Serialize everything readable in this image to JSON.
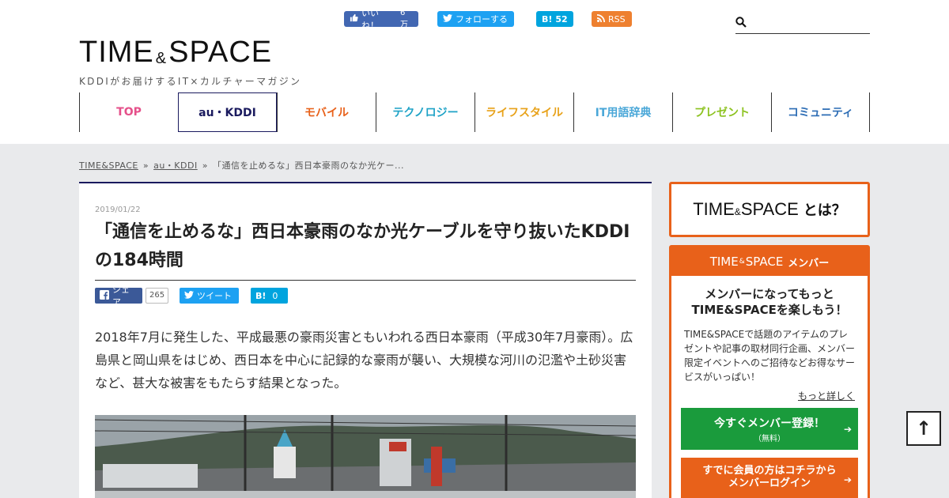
{
  "header": {
    "logo_main_a": "TIME",
    "logo_amp": "&",
    "logo_main_b": "SPACE",
    "logo_sub": "KDDIがお届けするIT×カルチャーマガジン",
    "social": {
      "fb_label": "いいね！",
      "fb_count": "6万",
      "tw_label": "フォローする",
      "hb_label": "B!",
      "hb_count": "52",
      "rss_label": "RSS"
    },
    "search_placeholder": ""
  },
  "nav": [
    {
      "label": "TOP",
      "color": "#e5508a"
    },
    {
      "label": "au・KDDI",
      "color": "#1a1a5e"
    },
    {
      "label": "モバイル",
      "color": "#e8611a"
    },
    {
      "label": "テクノロジー",
      "color": "#1fa3c7"
    },
    {
      "label": "ライフスタイル",
      "color": "#e8a21a"
    },
    {
      "label": "IT用語辞典",
      "color": "#4aa7d8"
    },
    {
      "label": "プレゼント",
      "color": "#8cc21f"
    },
    {
      "label": "コミュニティ",
      "color": "#2d6db5"
    }
  ],
  "breadcrumb": {
    "home": "TIME&SPACE",
    "cat": "au・KDDI",
    "current": "「通信を止めるな」西日本豪雨のなか光ケー..."
  },
  "article": {
    "date": "2019/01/22",
    "title": "「通信を止めるな」西日本豪雨のなか光ケーブルを守り抜いたKDDIの184時間",
    "share_fb": "シェア",
    "share_fb_count": "265",
    "share_tw": "ツイート",
    "share_hb": "B!",
    "share_hb_count": "0",
    "lead": "2018年7月に発生した、平成最悪の豪雨災害ともいわれる西日本豪雨（平成30年7月豪雨）。広島県と岡山県をはじめ、西日本を中心に記録的な豪雨が襲い、大規模な河川の氾濫や土砂災害など、甚大な被害をもたらす結果となった。"
  },
  "sidebar": {
    "about_a": "TIME",
    "about_amp": "&",
    "about_b": "SPACE",
    "about_ha": "とは？",
    "member_head_a": "TIME",
    "member_head_amp": "&",
    "member_head_b": "SPACE",
    "member_head_jp": "メンバー",
    "member_catch_1": "メンバーになってもっと",
    "member_catch_2": "TIME&SPACEを楽しもう！",
    "member_desc": "TIME&SPACEで話題のアイテムのプレゼントや記事の取材同行企画、メンバー限定イベントへのご招待などお得なサービスがいっぱい！",
    "member_more": "もっと詳しく",
    "register_1": "今すぐメンバー登録！",
    "register_2": "（無料）",
    "login_1": "すでに会員の方はコチラから",
    "login_2": "メンバーログイン"
  },
  "pagetop_label": "↑",
  "colors": {
    "accent": "#e8611a",
    "navy": "#1a1a5e",
    "green": "#1a9b3c"
  }
}
